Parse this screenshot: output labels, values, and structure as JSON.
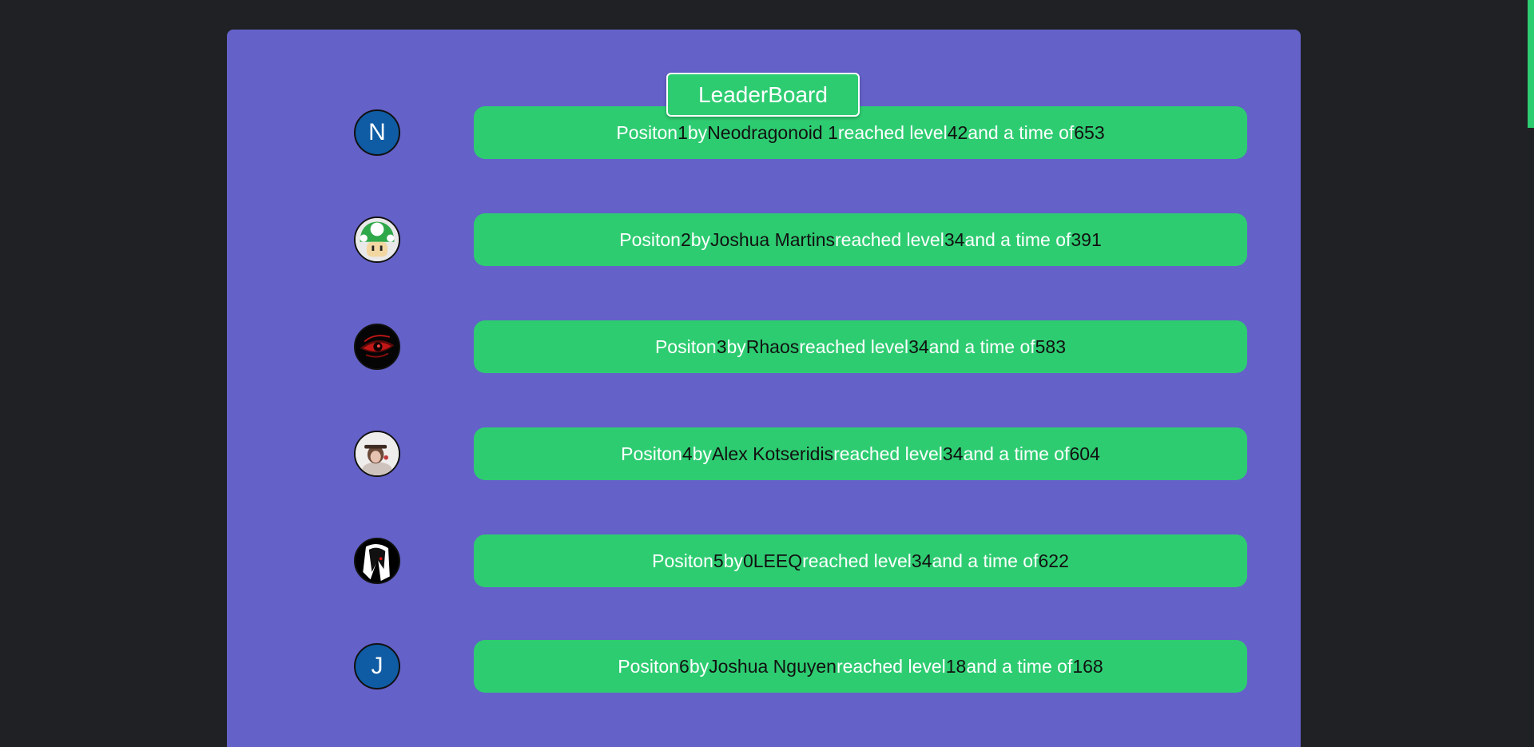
{
  "header": {
    "title": "LeaderBoard"
  },
  "labels": {
    "position": "Positon",
    "by": "by",
    "reached_level": "reached level",
    "and_time": "and a time of"
  },
  "colors": {
    "background": "#202124",
    "panel": "#6461c8",
    "accent": "#2ecc71",
    "avatar_letter_bg": "#0f5ba4"
  },
  "entries": [
    {
      "position": "1",
      "name": "Neodragonoid 1",
      "level": "42",
      "time": "653",
      "avatar": {
        "type": "letter",
        "letter": "N"
      }
    },
    {
      "position": "2",
      "name": "Joshua Martins",
      "level": "34",
      "time": "391",
      "avatar": {
        "type": "image",
        "icon": "green-mushroom-icon"
      }
    },
    {
      "position": "3",
      "name": "Rhaos",
      "level": "34",
      "time": "583",
      "avatar": {
        "type": "image",
        "icon": "red-eye-icon"
      }
    },
    {
      "position": "4",
      "name": "Alex Kotseridis",
      "level": "34",
      "time": "604",
      "avatar": {
        "type": "image",
        "icon": "character-photo-icon"
      }
    },
    {
      "position": "5",
      "name": "0LEEQ",
      "level": "34",
      "time": "622",
      "avatar": {
        "type": "image",
        "icon": "dark-hair-character-icon"
      }
    },
    {
      "position": "6",
      "name": "Joshua Nguyen",
      "level": "18",
      "time": "168",
      "avatar": {
        "type": "letter",
        "letter": "J"
      }
    }
  ]
}
